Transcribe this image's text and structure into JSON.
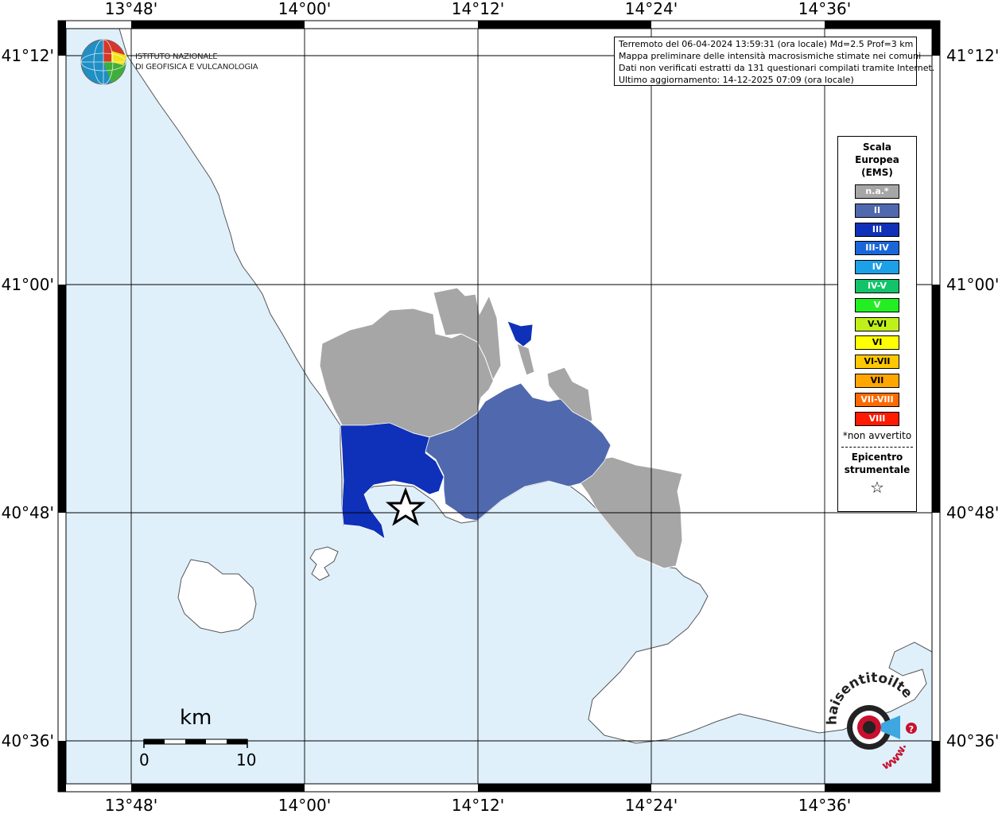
{
  "map": {
    "lon_ticks": [
      "13°48'",
      "14°00'",
      "14°12'",
      "14°24'",
      "14°36'"
    ],
    "lat_ticks": [
      "41°12'",
      "41°00'",
      "40°48'",
      "40°36'"
    ],
    "colors": {
      "sea": "#dff0fb",
      "land": "#ffffff",
      "not_felt": "#a6a6a6",
      "intensity_II": "#5068ad",
      "intensity_III": "#0f30b8"
    }
  },
  "logo": {
    "line1": "ISTITUTO NAZIONALE",
    "line2": "DI GEOFISICA E VULCANOLOGIA"
  },
  "info": {
    "line1": "Terremoto del 06-04-2024 13:59:31 (ora locale) Md=2.5 Prof=3 km",
    "line2": "Mappa preliminare delle intensità macrosismiche stimate nei comuni",
    "line3": "Dati non verificati estratti da 131 questionari compilati tramite Internet.",
    "line4": "Ultimo aggiornamento: 14-12-2025 07:09 (ora locale)"
  },
  "legend": {
    "title1": "Scala",
    "title2": "Europea",
    "title3": "(EMS)",
    "items": [
      {
        "label": "n.a.*",
        "color": "#a6a6a6"
      },
      {
        "label": "II",
        "color": "#5068ad"
      },
      {
        "label": "III",
        "color": "#0f30b8"
      },
      {
        "label": "III-IV",
        "color": "#1a66d9"
      },
      {
        "label": "IV",
        "color": "#1ca0e8"
      },
      {
        "label": "IV-V",
        "color": "#13c36a"
      },
      {
        "label": "V",
        "color": "#22ee22"
      },
      {
        "label": "V-VI",
        "color": "#bff01a"
      },
      {
        "label": "VI",
        "color": "#ffff00"
      },
      {
        "label": "VI-VII",
        "color": "#ffc800"
      },
      {
        "label": "VII",
        "color": "#ffa600"
      },
      {
        "label": "VII-VIII",
        "color": "#ff6a00"
      },
      {
        "label": "VIII",
        "color": "#ff1a00"
      }
    ],
    "note": "*non avvertito",
    "epicentre1": "Epicentro",
    "epicentre2": "strumentale",
    "epicentre_symbol": "☆"
  },
  "scalebar": {
    "unit": "km",
    "min": "0",
    "max": "10"
  },
  "watermark": {
    "line1": "haisentitoilterremoto.it",
    "line2": "www."
  }
}
